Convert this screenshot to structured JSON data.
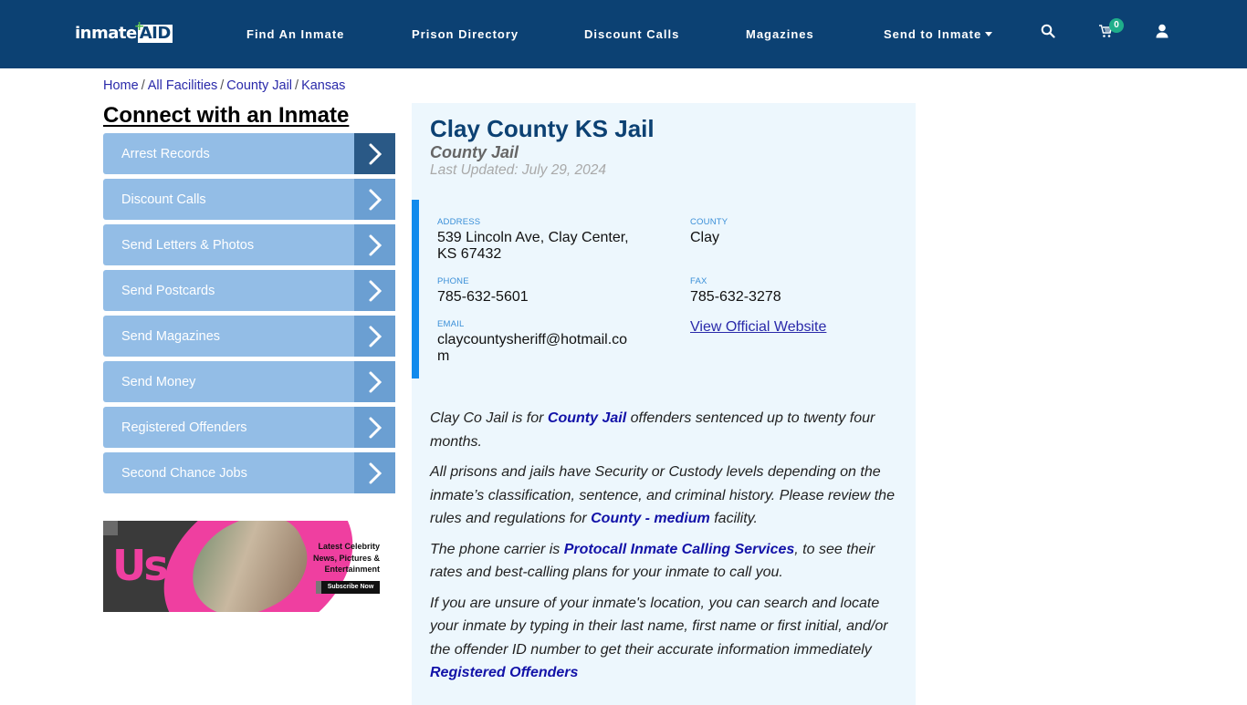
{
  "header": {
    "logo": {
      "part1": "inmate",
      "part2": "AID",
      "plus": "+"
    },
    "nav": [
      {
        "label": "Find An Inmate"
      },
      {
        "label": "Prison Directory"
      },
      {
        "label": "Discount Calls"
      },
      {
        "label": "Magazines"
      },
      {
        "label": "Send to Inmate",
        "has_dropdown": true
      }
    ],
    "icons": {
      "search": "search-icon",
      "cart": "cart-icon",
      "user": "user-icon"
    },
    "cart_count": "0"
  },
  "breadcrumb": [
    {
      "label": "Home"
    },
    {
      "label": "All Facilities"
    },
    {
      "label": "County Jail"
    },
    {
      "label": "Kansas"
    }
  ],
  "breadcrumb_separator": "/",
  "sidebar": {
    "title": "Connect with an Inmate",
    "items": [
      {
        "label": "Arrest Records",
        "active": true
      },
      {
        "label": "Discount Calls"
      },
      {
        "label": "Send Letters & Photos"
      },
      {
        "label": "Send Postcards"
      },
      {
        "label": "Send Magazines"
      },
      {
        "label": "Send Money"
      },
      {
        "label": "Registered Offenders"
      },
      {
        "label": "Second Chance Jobs"
      }
    ],
    "ad": {
      "brand": "Us",
      "line1": "Latest Celebrity",
      "line2": "News, Pictures &",
      "line3": "Entertainment",
      "button": "Subscribe Now"
    }
  },
  "facility": {
    "name": "Clay County KS Jail",
    "type": "County Jail",
    "last_updated": "Last Updated: July 29, 2024",
    "address_label": "ADDRESS",
    "address": "539 Lincoln Ave, Clay Center, KS 67432",
    "county_label": "COUNTY",
    "county": "Clay",
    "phone_label": "PHONE",
    "phone": "785-632-5601",
    "fax_label": "FAX",
    "fax": "785-632-3278",
    "email_label": "EMAIL",
    "email": "claycountysheriff@hotmail.com",
    "website_link": "View Official Website"
  },
  "description": {
    "p1": {
      "before": "Clay Co Jail is for ",
      "link": "County Jail",
      "after": " offenders sentenced up to twenty four months."
    },
    "p2": {
      "before": "All prisons and jails have Security or Custody levels depending on the inmate’s classification, sentence, and criminal history. Please review the rules and regulations for ",
      "link": "County - medium",
      "after": " facility."
    },
    "p3": {
      "before": "The phone carrier is ",
      "link": "Protocall Inmate Calling Services",
      "after": ", to see their rates and best-calling plans for your inmate to call you."
    },
    "p4": {
      "before": "If you are unsure of your inmate's location, you can search and locate your inmate by typing in their last name, first name or first initial, and/or the offender ID number to get their accurate information immediately",
      "link": "Registered Offenders"
    }
  },
  "colors": {
    "header_bg": "#0c4173",
    "sidebar_item": "#93bde6",
    "sidebar_arrow": "#6b9fd2",
    "sidebar_arrow_active": "#2a5986",
    "card_bg": "#edf7fd",
    "info_accent": "#118bed",
    "link": "#1212a8"
  }
}
